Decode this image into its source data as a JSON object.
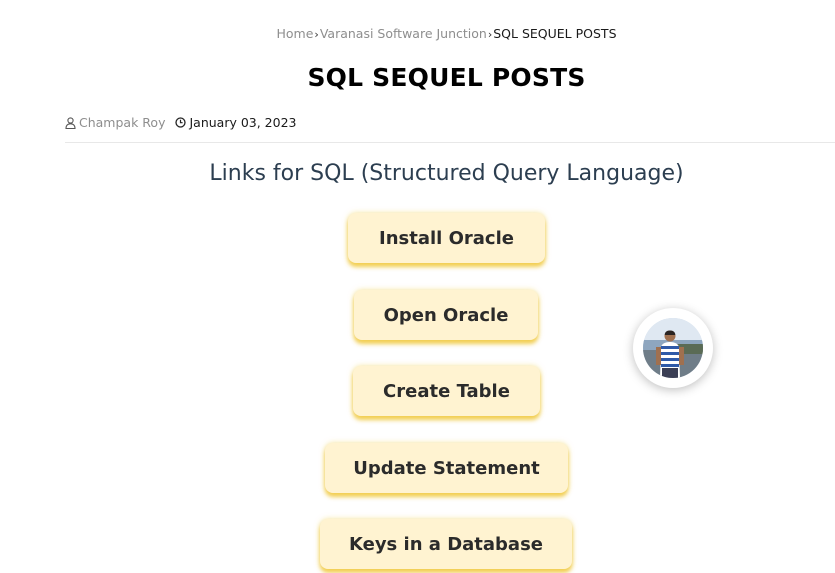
{
  "breadcrumb": {
    "home": "Home",
    "sep": "›",
    "category": "Varanasi Software Junction",
    "current": "SQL SEQUEL POSTS"
  },
  "post": {
    "title": "SQL SEQUEL POSTS",
    "author": "Champak Roy",
    "date": "January 03, 2023"
  },
  "content": {
    "heading": "Links for SQL (Structured Query Language)",
    "links": [
      {
        "label": "Install Oracle"
      },
      {
        "label": "Open Oracle"
      },
      {
        "label": "Create Table"
      },
      {
        "label": "Update Statement"
      },
      {
        "label": "Keys in a Database"
      }
    ]
  },
  "icons": {
    "author": "user-icon",
    "date": "clock-icon",
    "avatar": "profile-photo"
  },
  "colors": {
    "button_bg": "#fff3d1",
    "button_glow": "#f0c83c",
    "heading": "#2c3e50",
    "muted": "#8e8e8e"
  }
}
